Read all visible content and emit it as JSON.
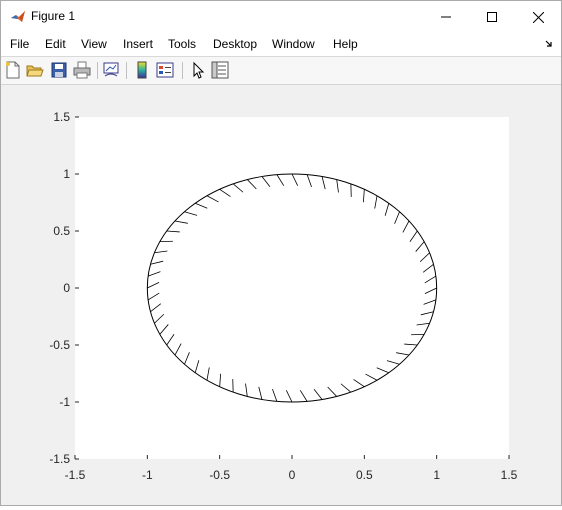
{
  "window": {
    "title": "Figure 1",
    "app_icon": "matlab-icon"
  },
  "controls": {
    "minimize": "minimize-icon",
    "maximize": "maximize-icon",
    "close": "close-icon"
  },
  "menu": {
    "items": [
      "File",
      "Edit",
      "View",
      "Insert",
      "Tools",
      "Desktop",
      "Window",
      "Help"
    ]
  },
  "toolbar": {
    "buttons": [
      "new-figure-icon",
      "open-file-icon",
      "save-icon",
      "print-icon",
      "link-plot-icon",
      "colorbar-icon",
      "legend-icon",
      "pointer-icon",
      "property-inspector-icon"
    ]
  },
  "chart_data": {
    "type": "line",
    "title": "",
    "xlabel": "",
    "ylabel": "",
    "xlim": [
      -1.5,
      1.5
    ],
    "ylim": [
      -1.5,
      1.5
    ],
    "xticks": [
      "-1.5",
      "-1",
      "-0.5",
      "0",
      "0.5",
      "1",
      "1.5"
    ],
    "yticks": [
      "-1.5",
      "-1",
      "-0.5",
      "0",
      "0.5",
      "1",
      "1.5"
    ],
    "grid": false,
    "series": [
      {
        "kind": "circle",
        "center": [
          0,
          0
        ],
        "radius": 1,
        "color": "#000000"
      },
      {
        "kind": "hatch",
        "count": 60,
        "direction": "inward",
        "color": "#000000"
      }
    ]
  }
}
